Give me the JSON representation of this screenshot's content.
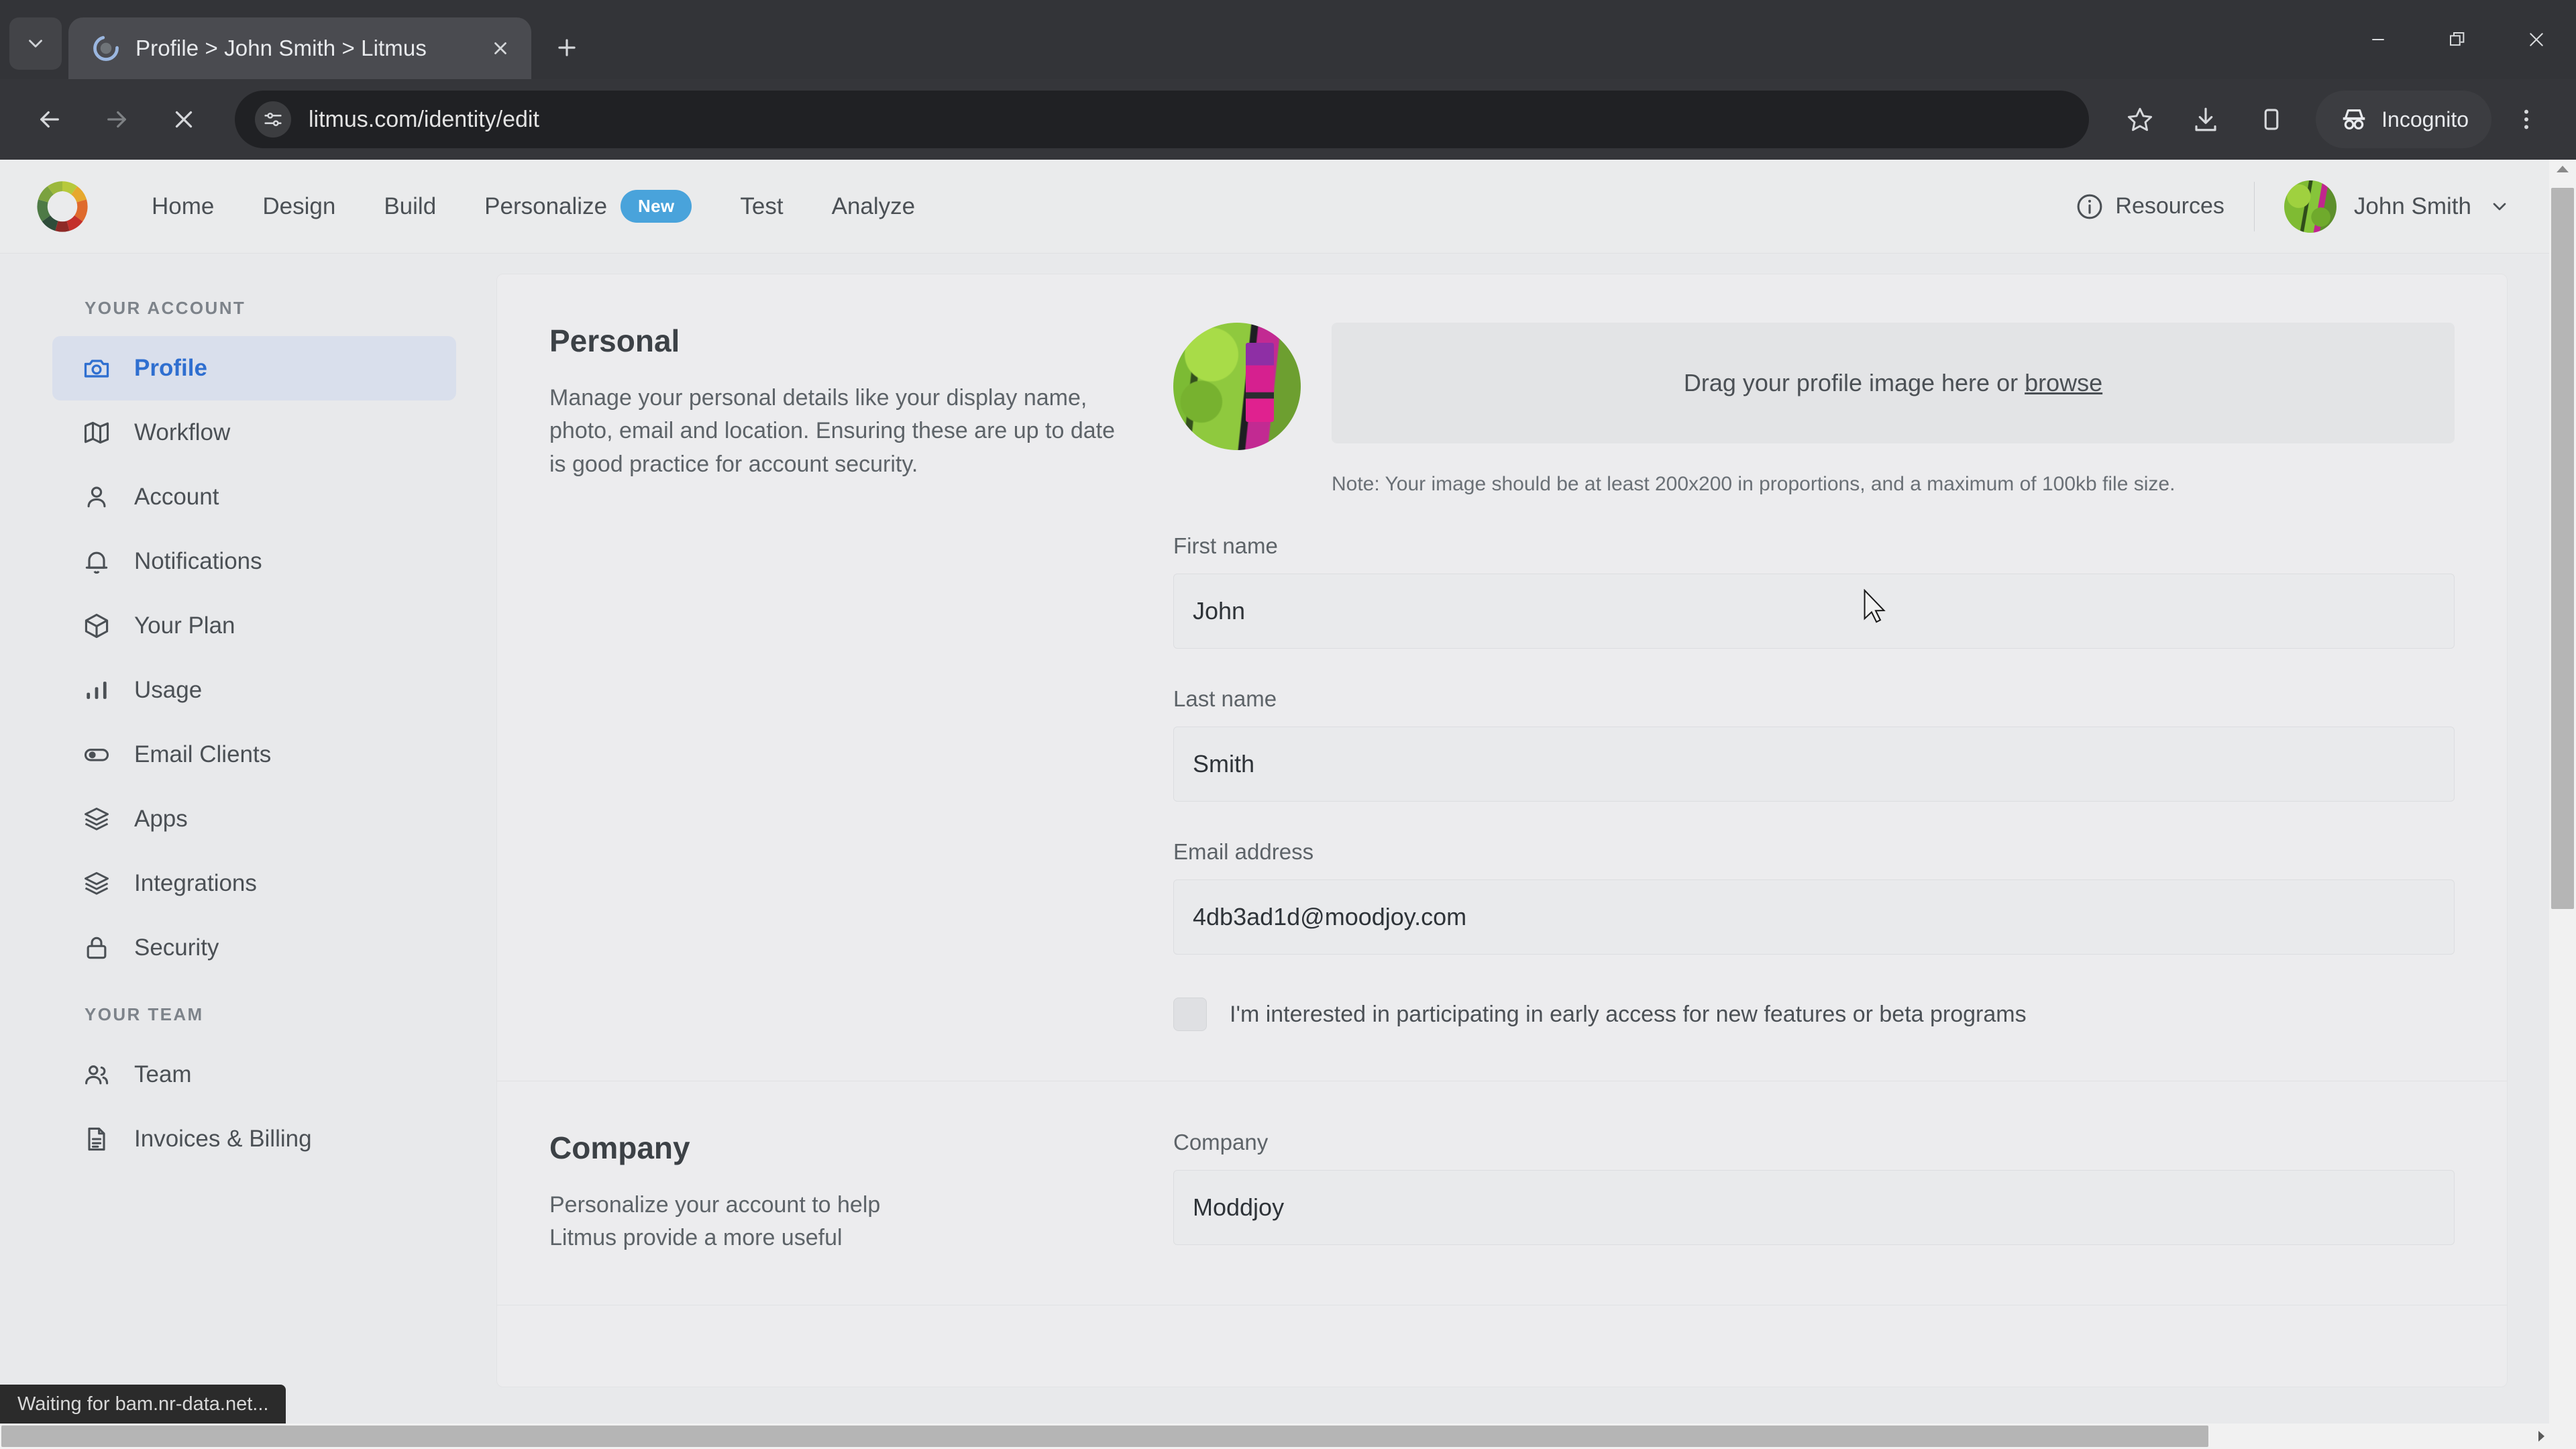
{
  "browser": {
    "tab": {
      "title": "Profile > John Smith > Litmus",
      "favicon_name": "litmus-loading-favicon"
    },
    "new_tab_label": "+",
    "url": "litmus.com/identity/edit",
    "incognito_label": "Incognito",
    "status_text": "Waiting for bam.nr-data.net...",
    "nav": {
      "back": "Back",
      "forward": "Forward",
      "stop": "Stop loading"
    },
    "window": {
      "minimize": "Minimize",
      "restore": "Restore",
      "close": "Close"
    }
  },
  "app": {
    "nav": [
      {
        "label": "Home"
      },
      {
        "label": "Design"
      },
      {
        "label": "Build"
      },
      {
        "label": "Personalize",
        "badge": "New"
      },
      {
        "label": "Test"
      },
      {
        "label": "Analyze"
      }
    ],
    "resources_label": "Resources",
    "user_name": "John Smith"
  },
  "sidebar": {
    "group_account_label": "YOUR ACCOUNT",
    "account_items": [
      {
        "label": "Profile",
        "icon": "camera-icon",
        "active": true
      },
      {
        "label": "Workflow",
        "icon": "map-icon"
      },
      {
        "label": "Account",
        "icon": "user-icon"
      },
      {
        "label": "Notifications",
        "icon": "bell-icon"
      },
      {
        "label": "Your Plan",
        "icon": "cube-icon"
      },
      {
        "label": "Usage",
        "icon": "bar-chart-icon"
      },
      {
        "label": "Email Clients",
        "icon": "toggle-icon"
      },
      {
        "label": "Apps",
        "icon": "layers-icon"
      },
      {
        "label": "Integrations",
        "icon": "layers-icon"
      },
      {
        "label": "Security",
        "icon": "lock-icon"
      }
    ],
    "group_team_label": "YOUR TEAM",
    "team_items": [
      {
        "label": "Team",
        "icon": "users-icon"
      },
      {
        "label": "Invoices & Billing",
        "icon": "document-icon"
      }
    ]
  },
  "personal": {
    "title": "Personal",
    "description": "Manage your personal details like your display name, photo, email and location. Ensuring these are up to date is good practice for account security.",
    "dropzone_text": "Drag your profile image here or ",
    "dropzone_link": "browse",
    "photo_note": "Note: Your image should be at least 200x200 in proportions, and a maximum of 100kb file size.",
    "fields": {
      "first_name_label": "First name",
      "first_name_value": "John",
      "last_name_label": "Last name",
      "last_name_value": "Smith",
      "email_label": "Email address",
      "email_value": "4db3ad1d@moodjoy.com"
    },
    "beta_checkbox_label": "I'm interested in participating in early access for new features or beta programs",
    "beta_checkbox_checked": false
  },
  "company": {
    "title": "Company",
    "description_line1": "Personalize your account to help",
    "description_line2": "Litmus provide a more useful",
    "field_label": "Company",
    "field_value": "Moddjoy"
  },
  "colors": {
    "accent_blue": "#2f6fd0",
    "badge_blue": "#49a3db",
    "page_bg": "#e8e9eb",
    "card_bg": "#ececee"
  }
}
